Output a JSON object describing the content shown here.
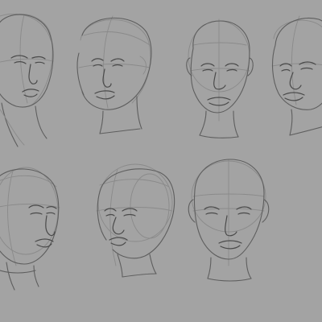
{
  "artwork": {
    "colors": {
      "paper": "#a3a3a3",
      "construction_line": "#8a8a8a",
      "outline": "#5e5e5e",
      "feature": "#4a4a4a"
    },
    "rows": [
      {
        "sketch_count": 4
      },
      {
        "sketch_count": 3
      }
    ]
  }
}
